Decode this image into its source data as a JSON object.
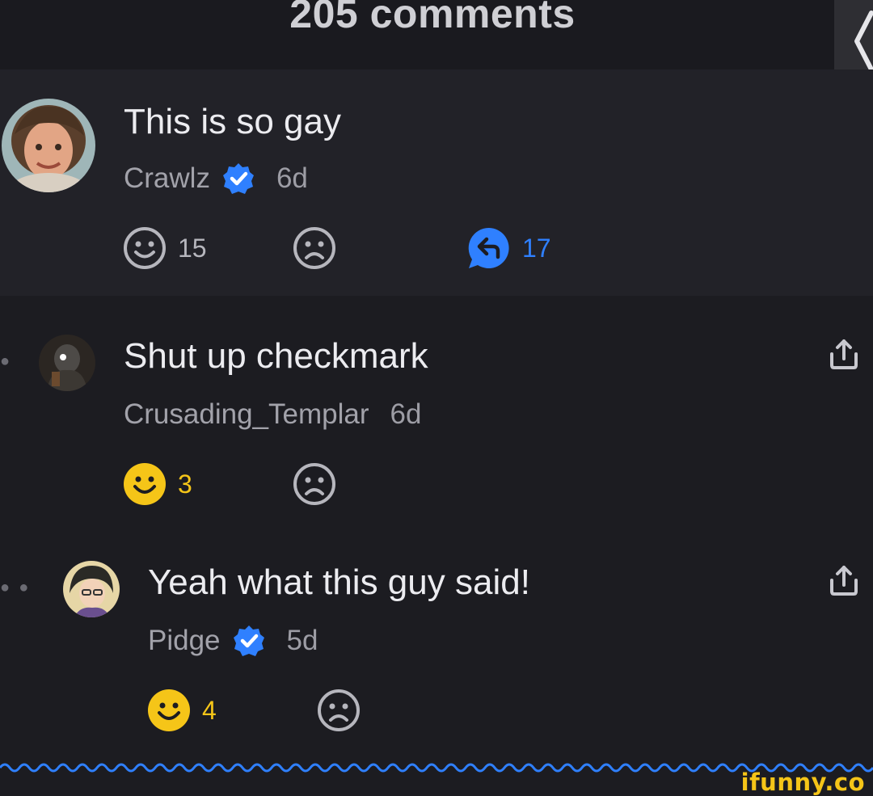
{
  "header": {
    "title": "205 comments"
  },
  "comments": [
    {
      "text": "This is so gay",
      "author": "Crawlz",
      "verified": true,
      "age": "6d",
      "smile_count": "15",
      "reply_count": "17"
    },
    {
      "text": "Shut up checkmark",
      "author": "Crusading_Templar",
      "verified": false,
      "age": "6d",
      "smile_count": "3"
    },
    {
      "text": "Yeah what this guy said!",
      "author": "Pidge",
      "verified": true,
      "age": "5d",
      "smile_count": "4"
    }
  ],
  "watermark": "ifunny.co",
  "colors": {
    "accent_blue": "#2f80ff",
    "smile_active": "#f5c518",
    "background": "#1c1c21"
  }
}
